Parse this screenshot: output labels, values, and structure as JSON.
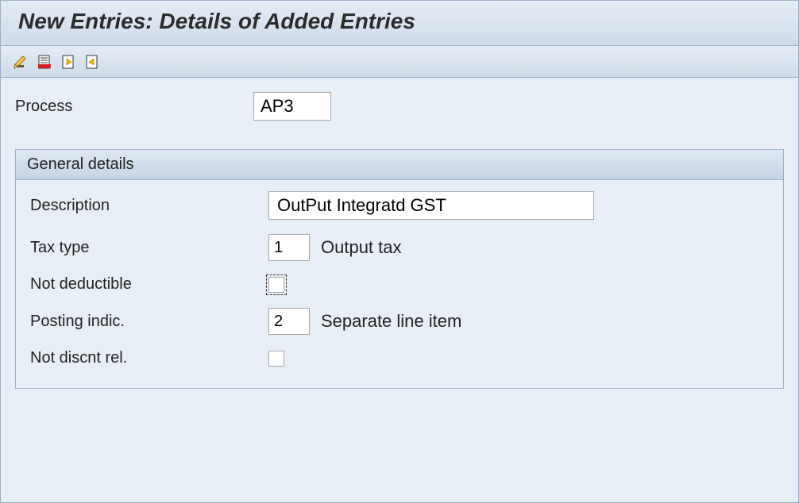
{
  "title": "New Entries: Details of Added Entries",
  "toolbar": {
    "icons": [
      "edit-icon",
      "delete-icon",
      "prev-entry-icon",
      "next-entry-icon"
    ]
  },
  "process": {
    "label": "Process",
    "value": "AP3"
  },
  "group": {
    "title": "General details",
    "description": {
      "label": "Description",
      "value": "OutPut Integratd GST"
    },
    "tax_type": {
      "label": "Tax type",
      "code": "1",
      "text": "Output tax"
    },
    "not_deductible": {
      "label": "Not deductible",
      "checked": false
    },
    "posting_indic": {
      "label": "Posting indic.",
      "code": "2",
      "text": "Separate line item"
    },
    "not_discnt_rel": {
      "label": "Not discnt rel.",
      "checked": false
    }
  }
}
